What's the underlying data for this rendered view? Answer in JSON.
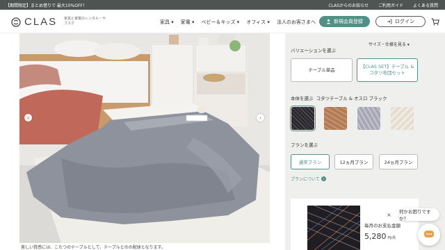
{
  "topbar": {
    "promo": "【期間限定】まとめ借りで 最大10%OFF！",
    "links": [
      "CLASからのお知らせ",
      "ご利用ガイド",
      "よくある質問"
    ]
  },
  "header": {
    "logo_text": "CLAS",
    "tagline": "家具と家電のレンタル・サブスク",
    "nav": [
      "家具",
      "家電",
      "ベビー＆キッズ",
      "オフィス"
    ],
    "corporate": "法人のお客さまへ",
    "register_label": "新規会員登録",
    "login_label": "ログイン"
  },
  "gallery": {
    "prev_icon": "chevron-left-icon",
    "next_icon": "chevron-right-icon",
    "caption": "美しい質感には、こたつのテーブルとして、テーブルとのの配球となります。"
  },
  "panel": {
    "size_spec_link": "サイズ・仕様を見る",
    "variation_heading": "バリエーションを選ぶ",
    "variations": [
      "テーブル単品",
      "【CLAS SET】テーブル & コタツ布団セット"
    ],
    "selected_variation": 1,
    "color_heading": "本体を選ぶ",
    "color_selected": "コタツテーブル & オスロ ブラック",
    "swatch_colors": [
      "#2a2830",
      "#b07c58",
      "#a7a8b4",
      "#e4dcd0"
    ],
    "selected_swatch": 0,
    "plan_heading": "プランを選ぶ",
    "plans": [
      "通常プラン",
      "12ヵ月プラン",
      "24ヵ月プラン"
    ],
    "selected_plan": 0,
    "about_plan": "プランについて",
    "monthly_label": "毎月のお支払金額",
    "price": "5,280",
    "price_unit": "円/月"
  },
  "chat": {
    "prompt": "何かお困りですか？",
    "close": "×"
  },
  "colors": {
    "accent": "#4f9185",
    "topbar": "#4d5451",
    "panel_bg": "#efefee"
  }
}
